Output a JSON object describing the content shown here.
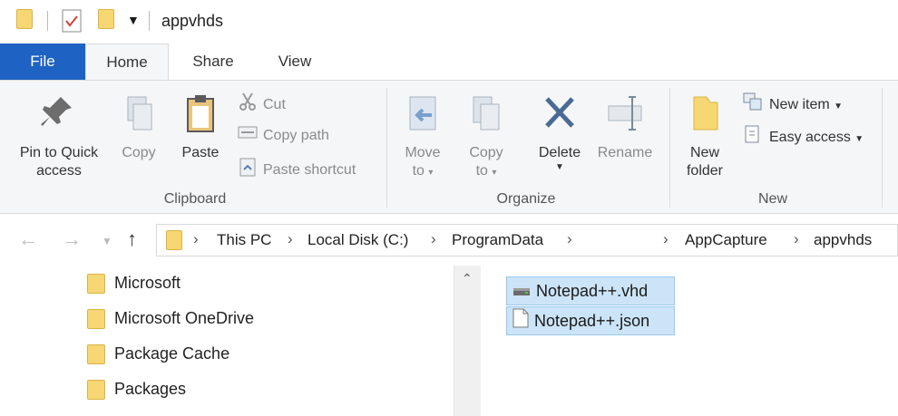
{
  "window": {
    "title": "appvhds"
  },
  "tabs": [
    "File",
    "Home",
    "Share",
    "View"
  ],
  "ribbon": {
    "clipboard": {
      "pin_label_1": "Pin to Quick",
      "pin_label_2": "access",
      "copy": "Copy",
      "paste": "Paste",
      "cut": "Cut",
      "copy_path": "Copy path",
      "paste_shortcut": "Paste shortcut",
      "group": "Clipboard"
    },
    "organize": {
      "move_1": "Move",
      "move_2": "to",
      "copy_1": "Copy",
      "copy_2": "to",
      "delete": "Delete",
      "rename": "Rename",
      "group": "Organize"
    },
    "new": {
      "new_folder_1": "New",
      "new_folder_2": "folder",
      "new_item": "New item",
      "easy_access": "Easy access",
      "group": "New"
    }
  },
  "address": {
    "crumbs": [
      "This PC",
      "Local Disk (C:)",
      "ProgramData",
      "AppCapture",
      "appvhds"
    ]
  },
  "nav_pane": {
    "items": [
      "Microsoft",
      "Microsoft OneDrive",
      "Package Cache",
      "Packages"
    ]
  },
  "files": [
    {
      "name": "Notepad++.vhd",
      "icon": "vhd-drive-icon",
      "selected": true
    },
    {
      "name": "Notepad++.json",
      "icon": "document-icon",
      "selected": true
    }
  ],
  "colors": {
    "file_tab": "#1e63c4",
    "selection": "#cce4f7",
    "folder": "#f7d774"
  }
}
